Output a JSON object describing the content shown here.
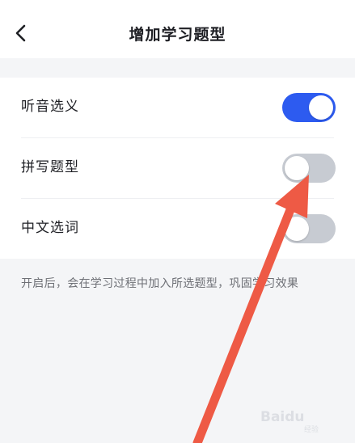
{
  "header": {
    "title": "增加学习题型",
    "back_icon": "chevron-left-icon"
  },
  "settings": [
    {
      "label": "听音选义",
      "enabled": true
    },
    {
      "label": "拼写题型",
      "enabled": false
    },
    {
      "label": "中文选词",
      "enabled": false
    }
  ],
  "hint": "开启后，会在学习过程中加入所选题型，巩固学习效果",
  "colors": {
    "toggle_on": "#2d5bf0",
    "toggle_off": "#c7cbd2",
    "annotation_arrow": "#ee5a45"
  },
  "watermark": {
    "brand": "Baidu",
    "sub": "经验"
  }
}
